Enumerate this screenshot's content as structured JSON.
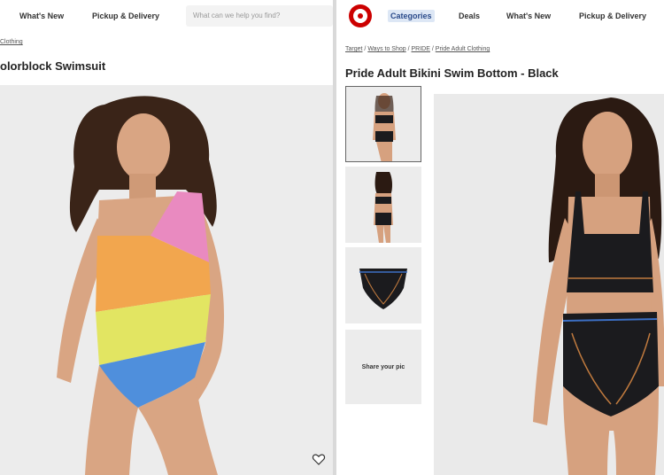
{
  "left": {
    "nav": {
      "whats_new": "What's New",
      "pickup": "Pickup & Delivery"
    },
    "search": {
      "placeholder": "What can we help you find?"
    },
    "breadcrumb": "Clothing",
    "product_title": "olorblock Swimsuit",
    "favorite_icon": "heart-icon"
  },
  "right": {
    "nav": {
      "categories": "Categories",
      "deals": "Deals",
      "whats_new": "What's New",
      "pickup": "Pickup & Delivery"
    },
    "logo_icon": "target-logo-icon",
    "breadcrumb": [
      "Target",
      "Ways to Shop",
      "PRIDE",
      "Pride Adult Clothing"
    ],
    "breadcrumb_sep": "/",
    "product_title": "Pride Adult Bikini Swim Bottom - Black",
    "share_label": "Share your pic"
  },
  "colors": {
    "target_red": "#cc0000",
    "swimsuit_pink": "#e98ac0",
    "swimsuit_orange": "#f2a64e",
    "swimsuit_yellow": "#e2e562",
    "swimsuit_blue": "#4f8fdc",
    "bikini_black": "#1b1b1e",
    "piping_orange": "#c07a3e",
    "piping_blue": "#3c6fc4"
  }
}
